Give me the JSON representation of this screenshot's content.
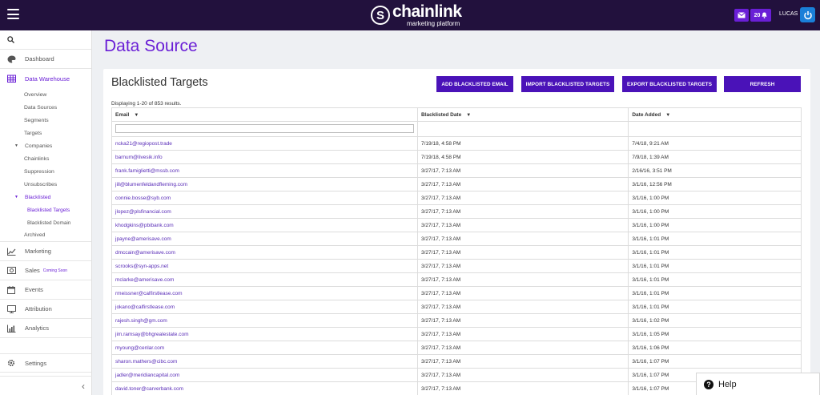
{
  "topbar": {
    "logo_name": "chainlink",
    "logo_tagline": "marketing platform",
    "notification_count": "20",
    "user_name": "LUCAS"
  },
  "sidebar": {
    "items": [
      {
        "label": "Dashboard",
        "icon": "palette-icon"
      },
      {
        "label": "Data Warehouse",
        "icon": "warehouse-icon"
      },
      {
        "label": "Marketing",
        "icon": "chart-line-icon"
      },
      {
        "label": "Sales",
        "icon": "money-icon",
        "badge": "Coming Soon"
      },
      {
        "label": "Events",
        "icon": "calendar-icon"
      },
      {
        "label": "Attribution",
        "icon": "monitor-icon"
      },
      {
        "label": "Analytics",
        "icon": "bar-chart-icon"
      },
      {
        "label": "Settings",
        "icon": "gear-icon"
      }
    ],
    "warehouse_sub": [
      "Overview",
      "Data Sources",
      "Segments",
      "Targets",
      "Companies",
      "Chainlinks",
      "Suppression",
      "Unsubscribes",
      "Blacklisted",
      "Archived"
    ],
    "blacklisted_sub": [
      "Blacklisted Targets",
      "Blacklisted Domain"
    ]
  },
  "page": {
    "title": "Data Source",
    "panel_title": "Blacklisted Targets",
    "results": "Displaying 1-20 of 853 results."
  },
  "buttons": {
    "add": "ADD BLACKLISTED EMAIL",
    "import": "IMPORT BLACKLISTED TARGETS",
    "export": "EXPORT BLACKLISTED TARGETS",
    "refresh": "REFRESH"
  },
  "table": {
    "headers": [
      "Email",
      "Blacklisted Date",
      "Date Added"
    ],
    "rows": [
      [
        "ncka21@regiopost.trade",
        "7/19/18, 4:58 PM",
        "7/4/18, 9:21 AM"
      ],
      [
        "barnum@livesik.info",
        "7/19/18, 4:58 PM",
        "7/9/18, 1:39 AM"
      ],
      [
        "frank.famiglietti@mssb.com",
        "3/27/17, 7:13 AM",
        "2/16/16, 3:51 PM"
      ],
      [
        "jill@blumenfeldandfleming.com",
        "3/27/17, 7:13 AM",
        "3/1/16, 12:56 PM"
      ],
      [
        "connie.bosse@syb.com",
        "3/27/17, 7:13 AM",
        "3/1/16, 1:00 PM"
      ],
      [
        "jlopez@plsfinancial.com",
        "3/27/17, 7:13 AM",
        "3/1/16, 1:00 PM"
      ],
      [
        "khodgkins@pbibank.com",
        "3/27/17, 7:13 AM",
        "3/1/16, 1:00 PM"
      ],
      [
        "jpayne@amerisave.com",
        "3/27/17, 7:13 AM",
        "3/1/16, 1:01 PM"
      ],
      [
        "dmccain@amerisave.com",
        "3/27/17, 7:13 AM",
        "3/1/16, 1:01 PM"
      ],
      [
        "scrooks@syn-apps.net",
        "3/27/17, 7:13 AM",
        "3/1/16, 1:01 PM"
      ],
      [
        "mclarke@amerisave.com",
        "3/27/17, 7:13 AM",
        "3/1/16, 1:01 PM"
      ],
      [
        "rmeissner@calfirstlease.com",
        "3/27/17, 7:13 AM",
        "3/1/16, 1:01 PM"
      ],
      [
        "jokano@calfirstlease.com",
        "3/27/17, 7:13 AM",
        "3/1/16, 1:01 PM"
      ],
      [
        "rajesh.singh@gm.com",
        "3/27/17, 7:13 AM",
        "3/1/16, 1:02 PM"
      ],
      [
        "jim.ramsay@bhgrealestate.com",
        "3/27/17, 7:13 AM",
        "3/1/16, 1:05 PM"
      ],
      [
        "myoung@cenlar.com",
        "3/27/17, 7:13 AM",
        "3/1/16, 1:06 PM"
      ],
      [
        "sharon.mathers@cibc.com",
        "3/27/17, 7:13 AM",
        "3/1/16, 1:07 PM"
      ],
      [
        "jadler@meridiancapital.com",
        "3/27/17, 7:13 AM",
        "3/1/16, 1:07 PM"
      ],
      [
        "david.toner@carverbank.com",
        "3/27/17, 7:13 AM",
        "3/1/16, 1:07 PM"
      ]
    ]
  },
  "help": {
    "label": "Help"
  },
  "colors": {
    "topbar": "#22113d",
    "accent": "#6a1fd6",
    "button": "#4a12b8",
    "power": "#1a7fd8"
  }
}
